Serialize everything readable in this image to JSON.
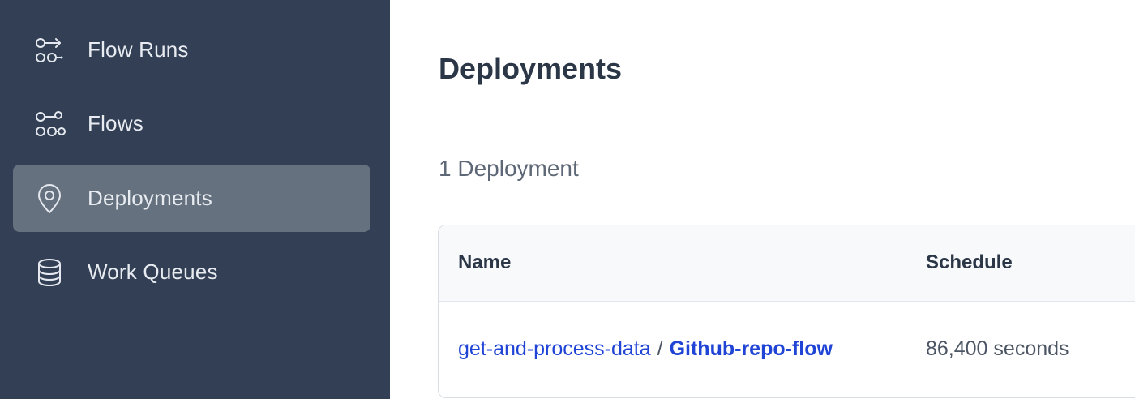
{
  "sidebar": {
    "items": [
      {
        "label": "Flow Runs",
        "icon": "flow-runs-icon",
        "active": false
      },
      {
        "label": "Flows",
        "icon": "flows-icon",
        "active": false
      },
      {
        "label": "Deployments",
        "icon": "location-pin-icon",
        "active": true
      },
      {
        "label": "Work Queues",
        "icon": "database-icon",
        "active": false
      }
    ]
  },
  "main": {
    "title": "Deployments",
    "count_text": "1 Deployment",
    "table": {
      "columns": [
        "Name",
        "Schedule"
      ],
      "rows": [
        {
          "flow_name": "get-and-process-data",
          "separator": "/",
          "deployment_name": "Github-repo-flow",
          "schedule": "86,400 seconds"
        }
      ]
    }
  },
  "colors": {
    "sidebar_bg": "#323f55",
    "active_item_bg": "#65717f",
    "link": "#1f44d6",
    "heading": "#2b3647"
  }
}
